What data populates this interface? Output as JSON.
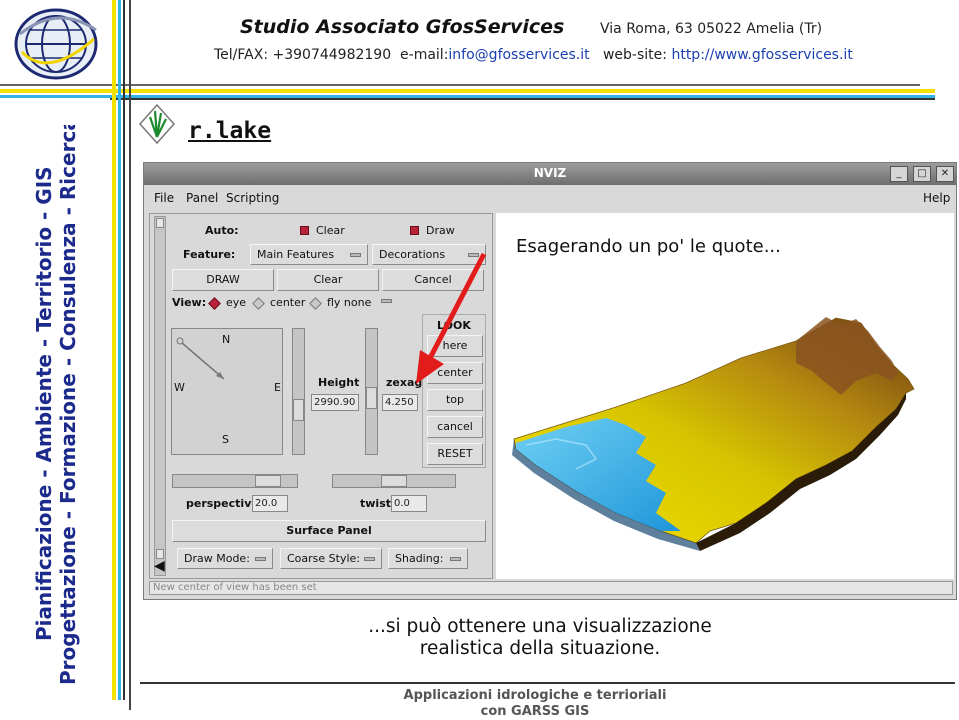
{
  "header": {
    "company": "Studio Associato GfosServices",
    "address": "Via Roma, 63 05022 Amelia (Tr)",
    "telfax": "Tel/FAX: +390744982190",
    "email_label": "e-mail:",
    "email": "info@gfosservices.it",
    "website_label": "web-site:",
    "website": "http://www.gfosservices.it"
  },
  "sidebar": {
    "line1": "Pianificazione - Ambiente - Territorio - GIS",
    "line2": "Progettazione - Formazione - Consulenza - Ricerca"
  },
  "page_title": "r.lake",
  "nviz": {
    "title": "NVIZ",
    "window_buttons": [
      "_",
      "□",
      "✕"
    ],
    "menu": {
      "file": "File",
      "panel": "Panel",
      "scripting": "Scripting",
      "help": "Help"
    },
    "auto_label": "Auto:",
    "clear_check": "Clear",
    "draw_check": "Draw",
    "feature_label": "Feature:",
    "feature_value": "Main Features",
    "decorations": "Decorations",
    "draw_btn": "DRAW",
    "clear_btn": "Clear",
    "cancel_btn": "Cancel",
    "view_label": "View:",
    "view_eye": "eye",
    "view_center": "center",
    "view_fly": "fly none",
    "compass": {
      "n": "N",
      "s": "S",
      "e": "E",
      "w": "W"
    },
    "height_label": "Height",
    "height_value": "2990.90",
    "zexag_label": "zexag",
    "zexag_value": "4.250",
    "look_label": "LOOK",
    "look_buttons": [
      "here",
      "center",
      "top",
      "cancel",
      "RESET"
    ],
    "perspective_label": "perspective",
    "perspective_value": "20.0",
    "twist_label": "twist",
    "twist_value": "0.0",
    "surface_panel": "Surface Panel",
    "draw_mode": "Draw Mode:",
    "coarse_style": "Coarse Style:",
    "shading": "Shading:",
    "status": "New center of view has been set"
  },
  "annotation": "Esagerando un po' le quote...",
  "caption": {
    "line1": "...si può ottenere una visualizzazione",
    "line2": "realistica della situazione."
  },
  "footer": {
    "line1": "Applicazioni idrologiche e terrioriali",
    "line2": "con GARSS GIS"
  },
  "colors": {
    "sidebar_text": "#1c2a8c",
    "accent_yellow": "#f5e100",
    "accent_blue": "#34b4e6",
    "annotation_arrow": "#e21b1b"
  }
}
